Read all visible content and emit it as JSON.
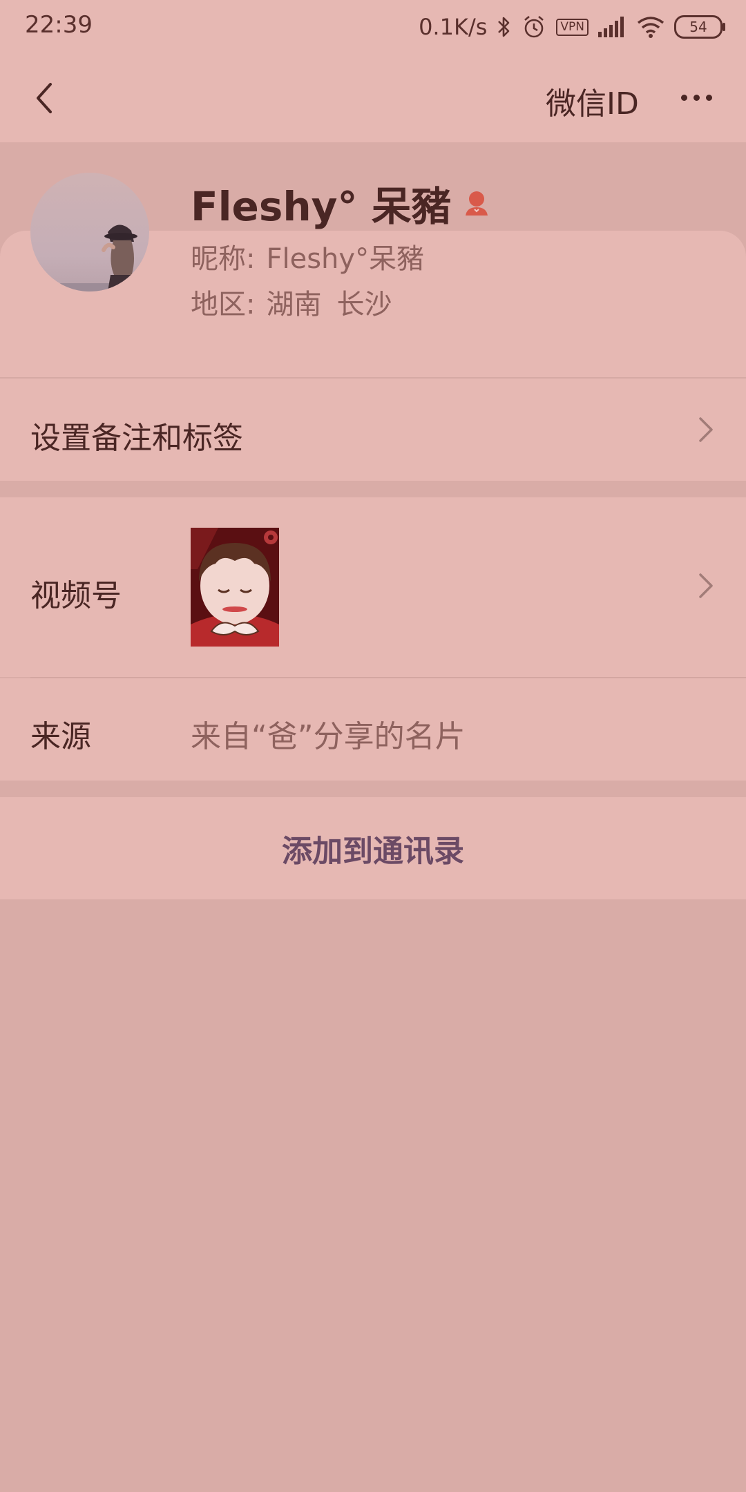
{
  "status_bar": {
    "time": "22:39",
    "net_speed": "0.1K/s",
    "vpn_label": "VPN",
    "battery": "54",
    "icons": [
      "bluetooth-icon",
      "alarm-icon",
      "vpn-icon",
      "signal-icon",
      "wifi-icon",
      "battery-icon"
    ]
  },
  "header": {
    "back_icon": "chevron-left-icon",
    "wechat_id_label": "微信ID",
    "more_icon": "more-dots-icon"
  },
  "profile": {
    "display_name": "Fleshy° 呆豬",
    "gender_icon": "female-icon",
    "nickname_label": "昵称:",
    "nickname": "Fleshy°呆豬",
    "region_label": "地区:",
    "region_province": "湖南",
    "region_city": "长沙"
  },
  "rows": {
    "remark_tags": "设置备注和标签",
    "channels_label": "视频号",
    "source_label": "来源",
    "source_value": "来自“爸”分享的名片"
  },
  "actions": {
    "add_contact": "添加到通讯录"
  },
  "colors": {
    "background": "#d9aca7",
    "surface": "#e6b8b3",
    "text_primary": "#4a2624",
    "text_secondary": "#8e625e",
    "action_text": "#6b4a65",
    "gender_icon": "#d95a4a"
  }
}
